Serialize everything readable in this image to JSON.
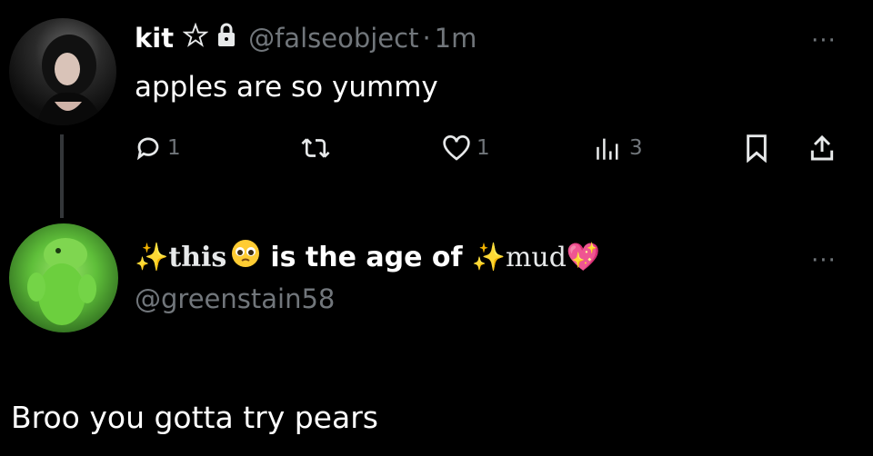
{
  "tweet1": {
    "display_name": "kit",
    "name_symbols": [
      "pentagram-icon",
      "lock-icon"
    ],
    "handle": "@falseobject",
    "separator": "·",
    "timestamp": "1m",
    "text": "apples are so yummy",
    "actions": {
      "reply_count": "1",
      "like_count": "1",
      "views_count": "3"
    },
    "more_label": "···"
  },
  "tweet2": {
    "display_name_parts": {
      "part1": "this",
      "part2": "is the age of",
      "part3": "mud"
    },
    "emojis": [
      "sparkles-icon",
      "pleading-face-icon",
      "sparkles-icon",
      "sparkling-heart-icon"
    ],
    "handle": "@greenstain58",
    "text": "Broo you gotta try pears",
    "more_label": "···"
  },
  "colors": {
    "background": "#000000",
    "text": "#ffffff",
    "muted": "#71767b",
    "sparkle": "#ffd84a",
    "heart": "#ff4fa8"
  }
}
